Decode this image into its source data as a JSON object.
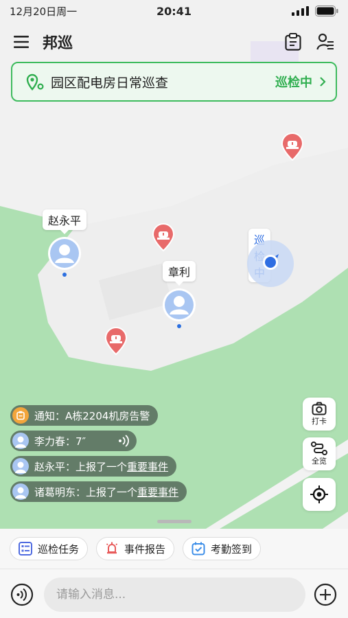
{
  "status_bar": {
    "date": "12月20日周一",
    "time": "20:41"
  },
  "header": {
    "title": "邦巡",
    "menu_icon": "menu-icon",
    "clipboard_icon": "clipboard-icon",
    "user_list_icon": "user-list-icon"
  },
  "route": {
    "name": "园区配电房日常巡查",
    "state": "巡检中"
  },
  "map": {
    "people": [
      {
        "name": "赵永平"
      },
      {
        "name": "章利"
      }
    ],
    "me_label": "巡检中",
    "alarm_icon": "alarm-icon",
    "colors": {
      "land": "#aee0b2",
      "road": "#efefef",
      "alarm": "#e86a6a",
      "me": "#2f6ee2"
    }
  },
  "tools": [
    {
      "label": "打卡",
      "icon": "camera-icon"
    },
    {
      "label": "全览",
      "icon": "route-icon"
    },
    {
      "label": "",
      "icon": "locate-icon"
    }
  ],
  "notifications": [
    {
      "prefix": "通知：A栋2204机房告警",
      "link": "",
      "type": "notice"
    },
    {
      "prefix": "李力春：7″",
      "link": "",
      "type": "voice"
    },
    {
      "prefix": "赵永平：上报了一个",
      "link": "重要事件",
      "type": "event"
    },
    {
      "prefix": "诸葛明东：上报了一个",
      "link": "重要事件",
      "type": "event"
    }
  ],
  "bottom": {
    "chips": [
      {
        "label": "巡检任务",
        "icon": "task-list-icon"
      },
      {
        "label": "事件报告",
        "icon": "alarm-bell-icon"
      },
      {
        "label": "考勤签到",
        "icon": "calendar-check-icon"
      }
    ],
    "input_placeholder": "请输入消息..."
  }
}
